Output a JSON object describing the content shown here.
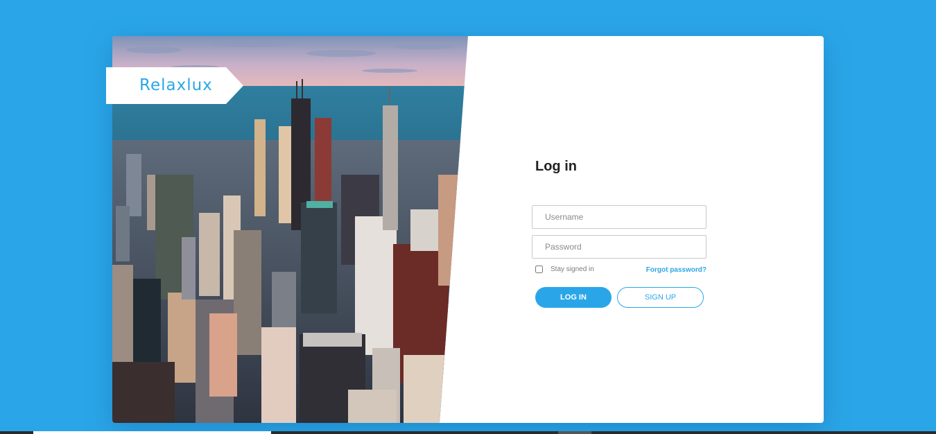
{
  "brand": {
    "logo_text": "Relaxlux"
  },
  "login": {
    "title": "Log in",
    "username_placeholder": "Username",
    "password_placeholder": "Password",
    "stay_signed_in_label": "Stay signed in",
    "forgot_password_label": "Forgot password?",
    "login_button_label": "LOG IN",
    "signup_button_label": "SIGN UP"
  },
  "colors": {
    "accent": "#2aa6e8",
    "background": "#2aa6e8",
    "card": "#ffffff"
  }
}
